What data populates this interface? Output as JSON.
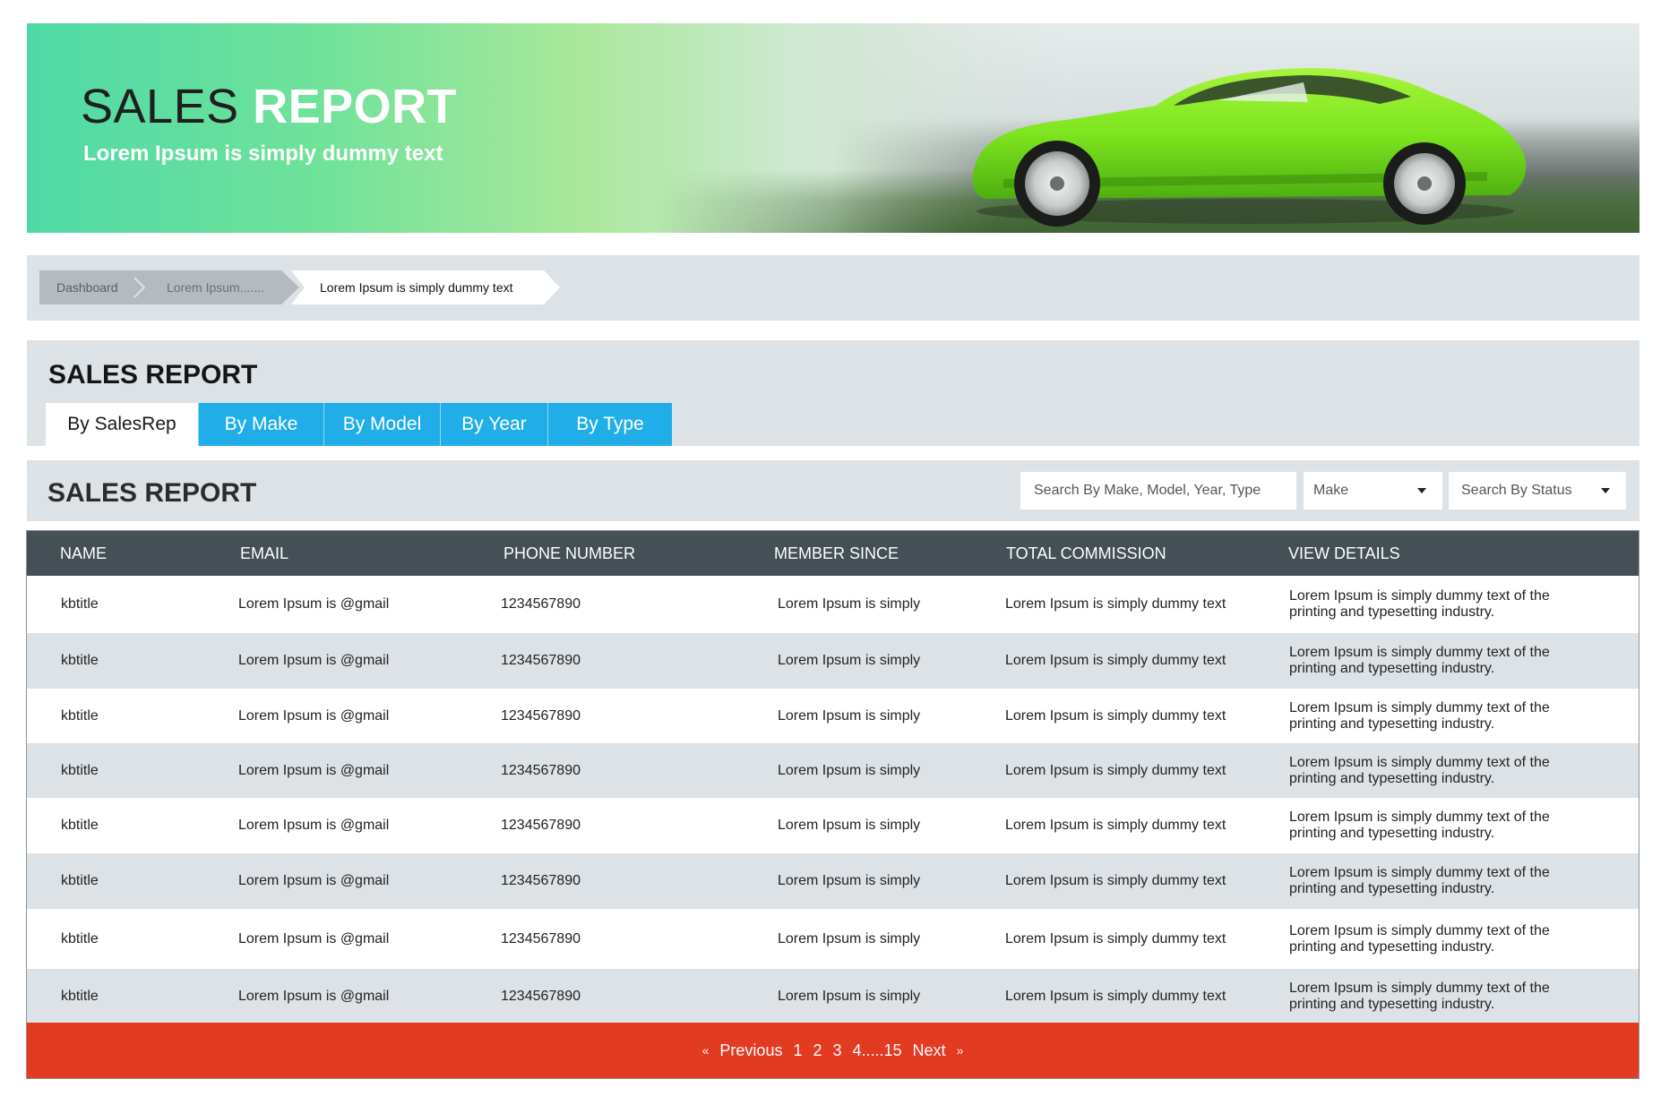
{
  "hero": {
    "title_part1": "SALES",
    "title_part2": "REPORT",
    "subtitle": "Lorem Ipsum is simply dummy text"
  },
  "breadcrumb": {
    "items": [
      {
        "label": "Dashboard"
      },
      {
        "label": "Lorem Ipsum......."
      },
      {
        "label": "Lorem Ipsum is simply dummy text"
      }
    ]
  },
  "tab_panel": {
    "title": "SALES REPORT",
    "tabs": [
      {
        "label": "By SalesRep",
        "active": true
      },
      {
        "label": "By Make",
        "active": false
      },
      {
        "label": "By Model",
        "active": false
      },
      {
        "label": "By Year",
        "active": false
      },
      {
        "label": "By Type",
        "active": false
      }
    ]
  },
  "list": {
    "title": "SALES REPORT",
    "search_placeholder": "Search By Make, Model, Year, Type",
    "make_select": "Make",
    "status_select": "Search By Status"
  },
  "table": {
    "columns": [
      "NAME",
      "EMAIL",
      "PHONE NUMBER",
      "MEMBER SINCE",
      "TOTAL COMMISSION",
      "VIEW DETAILS"
    ],
    "rows": [
      {
        "name": "kbtitle",
        "email": "Lorem Ipsum is @gmail",
        "phone": "1234567890",
        "member_since": "Lorem Ipsum is simply",
        "commission": "Lorem Ipsum is simply dummy text",
        "details": "Lorem Ipsum is simply dummy text of the printing and typesetting industry."
      },
      {
        "name": "kbtitle",
        "email": "Lorem Ipsum is @gmail",
        "phone": "1234567890",
        "member_since": "Lorem Ipsum is simply",
        "commission": "Lorem Ipsum is simply dummy text",
        "details": "Lorem Ipsum is simply dummy text of the printing and typesetting industry."
      },
      {
        "name": "kbtitle",
        "email": "Lorem Ipsum is @gmail",
        "phone": "1234567890",
        "member_since": "Lorem Ipsum is simply",
        "commission": "Lorem Ipsum is simply dummy text",
        "details": "Lorem Ipsum is simply dummy text of the printing and typesetting industry."
      },
      {
        "name": "kbtitle",
        "email": "Lorem Ipsum is @gmail",
        "phone": "1234567890",
        "member_since": "Lorem Ipsum is simply",
        "commission": "Lorem Ipsum is simply dummy text",
        "details": "Lorem Ipsum is simply dummy text of the printing and typesetting industry."
      },
      {
        "name": "kbtitle",
        "email": "Lorem Ipsum is @gmail",
        "phone": "1234567890",
        "member_since": "Lorem Ipsum is simply",
        "commission": "Lorem Ipsum is simply dummy text",
        "details": "Lorem Ipsum is simply dummy text of the printing and typesetting industry."
      },
      {
        "name": "kbtitle",
        "email": "Lorem Ipsum is @gmail",
        "phone": "1234567890",
        "member_since": "Lorem Ipsum is simply",
        "commission": "Lorem Ipsum is simply dummy text",
        "details": "Lorem Ipsum is simply dummy text of the printing and typesetting industry."
      },
      {
        "name": "kbtitle",
        "email": "Lorem Ipsum is @gmail",
        "phone": "1234567890",
        "member_since": "Lorem Ipsum is simply",
        "commission": "Lorem Ipsum is simply dummy text",
        "details": "Lorem Ipsum is simply dummy text of the printing and typesetting industry."
      },
      {
        "name": "kbtitle",
        "email": "Lorem Ipsum is @gmail",
        "phone": "1234567890",
        "member_since": "Lorem Ipsum is simply",
        "commission": "Lorem Ipsum is simply dummy text",
        "details": "Lorem Ipsum is simply dummy text of the printing and typesetting industry."
      }
    ]
  },
  "pagination": {
    "prev_icon": "double-chevron-left-icon",
    "previous": "Previous",
    "pages": [
      "1",
      "2",
      "3",
      "4.....15"
    ],
    "next": "Next",
    "next_icon": "double-chevron-right-icon"
  },
  "colors": {
    "tab_blue": "#21aee8",
    "header_dark": "#444f56",
    "pager_red": "#e33a22",
    "panel_gray": "#dde2e6",
    "car_green": "#7ee51f"
  }
}
